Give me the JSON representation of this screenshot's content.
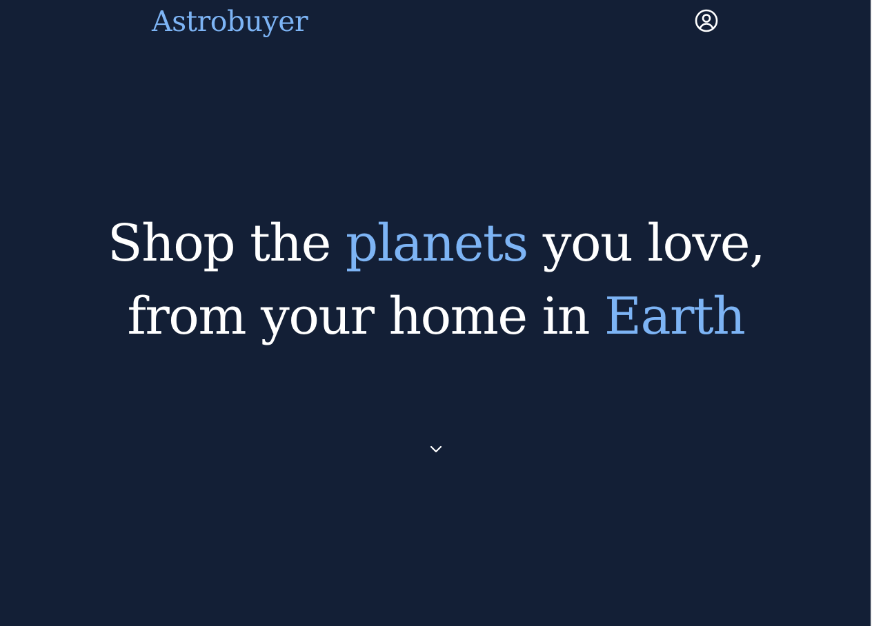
{
  "header": {
    "logo_text": "Astrobuyer",
    "account_icon": "user-circle-icon"
  },
  "hero": {
    "line1": {
      "before": "Shop the ",
      "highlight": "planets",
      "after": " you love,"
    },
    "line2": {
      "before": "from your home in ",
      "highlight": "Earth"
    }
  },
  "scroll": {
    "icon": "chevron-down-icon"
  },
  "colors": {
    "background": "#131f36",
    "accent": "#7db4f5",
    "text": "#ffffff"
  }
}
